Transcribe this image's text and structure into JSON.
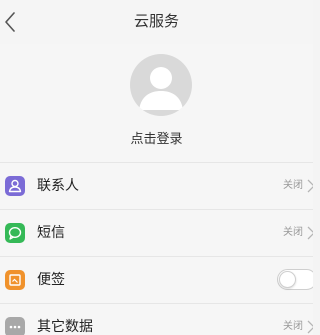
{
  "header": {
    "title": "云服务",
    "back_icon": "chevron-left-icon"
  },
  "profile": {
    "avatar_icon": "default-avatar-icon",
    "login_label": "点击登录"
  },
  "list": {
    "items": [
      {
        "label": "联系人",
        "status": "关闭",
        "icon": "contacts-icon",
        "icon_color": "#7b6bd6"
      },
      {
        "label": "短信",
        "status": "关闭",
        "icon": "message-icon",
        "icon_color": "#35b957"
      },
      {
        "label": "便签",
        "toggle_on": false,
        "icon": "notes-icon",
        "icon_color": "#f0922c"
      },
      {
        "label": "其它数据",
        "status": "关闭",
        "icon": "more-data-icon",
        "icon_color": "#a8a8a8"
      }
    ]
  },
  "colors": {
    "background": "#f4f4f4",
    "divider": "#e6e6e6",
    "text_primary": "#222222",
    "text_secondary": "#999999"
  }
}
